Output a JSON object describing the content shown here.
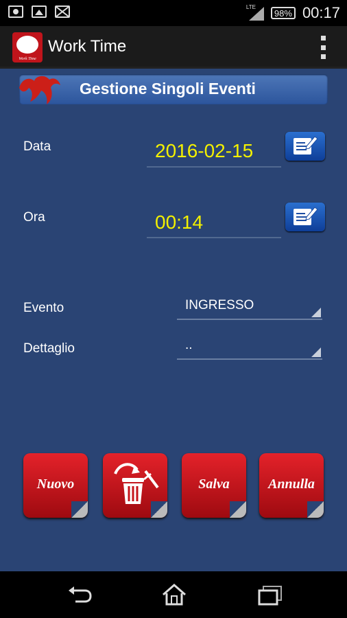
{
  "status_bar": {
    "battery": "98%",
    "time": "00:17",
    "network": "LTE"
  },
  "action_bar": {
    "app_title": "Work Time",
    "app_icon_caption": "Work Time"
  },
  "section": {
    "title": "Gestione Singoli Eventi"
  },
  "form": {
    "date_label": "Data",
    "date_value": "2016-02-15",
    "time_label": "Ora",
    "time_value": "00:14",
    "event_label": "Evento",
    "event_value": "INGRESSO",
    "detail_label": "Dettaglio",
    "detail_value": ".."
  },
  "buttons": {
    "new": "Nuovo",
    "save": "Salva",
    "cancel": "Annulla"
  },
  "colors": {
    "background": "#2a4474",
    "value_text": "#f3f000",
    "button_red": "#d1161d",
    "header_band": "#3f68ad"
  },
  "icons": [
    "camera-icon",
    "image-icon",
    "mail-icon",
    "signal-icon",
    "battery-icon",
    "overflow-menu-icon",
    "edit-icon",
    "trash-icon",
    "back-icon",
    "home-icon",
    "recents-icon"
  ]
}
